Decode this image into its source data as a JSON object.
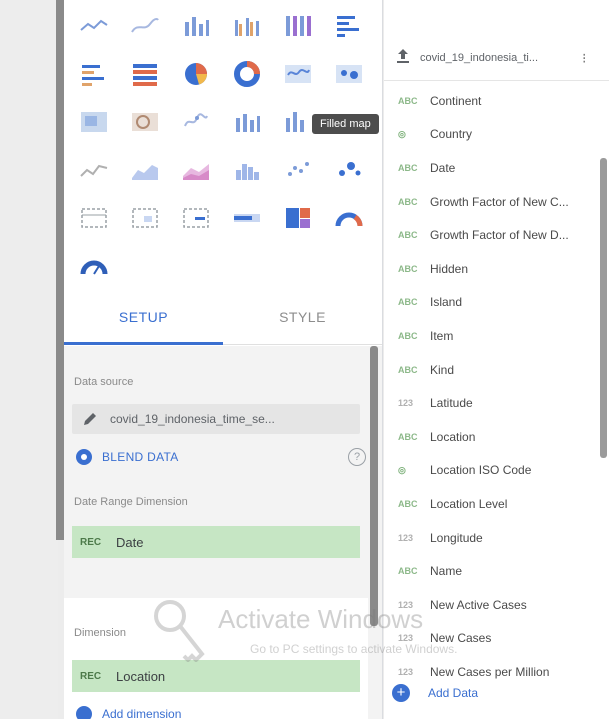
{
  "colors": {
    "accent": "#3a6fd0",
    "chip": "#c6e6c4",
    "tooltip_bg": "#4d4d4d"
  },
  "chart_picker": {
    "tooltip": "Filled map",
    "icons": [
      "line-chart-icon",
      "smooth-line-chart-icon",
      "column-chart-icon",
      "grouped-column-chart-icon",
      "stacked-column-chart-icon",
      "bar-chart-icon",
      "horizontal-bar-chart-icon",
      "stacked-bar-chart-icon",
      "pie-chart-icon",
      "donut-chart-icon",
      "geo-map-icon",
      "geo-chart-icon",
      "google-map-icon",
      "bubble-map-icon",
      "line-map-icon",
      "combo-chart-icon",
      "filled-map-icon",
      "placeholder",
      "time-series-icon",
      "area-chart-icon",
      "stacked-area-chart-icon",
      "histogram-icon",
      "scatter-chart-icon",
      "bubble-chart-icon",
      "pivot-table-icon",
      "pivot-heatmap-icon",
      "pivot-bars-icon",
      "bullet-chart-icon",
      "treemap-icon",
      "gauge-icon",
      "gauge-alt-icon"
    ]
  },
  "tabs": {
    "setup": "SETUP",
    "style": "STYLE"
  },
  "setup": {
    "data_source_label": "Data source",
    "data_source_name": "covid_19_indonesia_time_se...",
    "blend_label": "BLEND DATA",
    "help": "?",
    "date_range_label": "Date Range Dimension",
    "date_range_value": "Date",
    "dimension_label": "Dimension",
    "dimension_value": "Location",
    "add_dimension": "Add dimension",
    "type_tag": "REC"
  },
  "data_panel": {
    "source_name": "covid_19_indonesia_ti...",
    "more": "⁝",
    "fields": [
      {
        "label": "Continent",
        "type": "abc"
      },
      {
        "label": "Country",
        "type": "geo"
      },
      {
        "label": "Date",
        "type": "abc"
      },
      {
        "label": "Growth Factor of New C...",
        "type": "abc"
      },
      {
        "label": "Growth Factor of New D...",
        "type": "abc"
      },
      {
        "label": "Hidden",
        "type": "abc"
      },
      {
        "label": "Island",
        "type": "abc"
      },
      {
        "label": "Item",
        "type": "abc"
      },
      {
        "label": "Kind",
        "type": "abc"
      },
      {
        "label": "Latitude",
        "type": "num"
      },
      {
        "label": "Location",
        "type": "abc"
      },
      {
        "label": "Location ISO Code",
        "type": "geo"
      },
      {
        "label": "Location Level",
        "type": "abc"
      },
      {
        "label": "Longitude",
        "type": "num"
      },
      {
        "label": "Name",
        "type": "abc"
      },
      {
        "label": "New Active Cases",
        "type": "num"
      },
      {
        "label": "New Cases",
        "type": "num"
      },
      {
        "label": "New Cases per Million",
        "type": "num"
      }
    ],
    "type_labels": {
      "abc": "ABC",
      "num": "123",
      "geo": "◎"
    },
    "add_data": "Add Data"
  },
  "watermark": {
    "title": "Activate Windows",
    "subtitle": "Go to PC settings to activate Windows."
  }
}
